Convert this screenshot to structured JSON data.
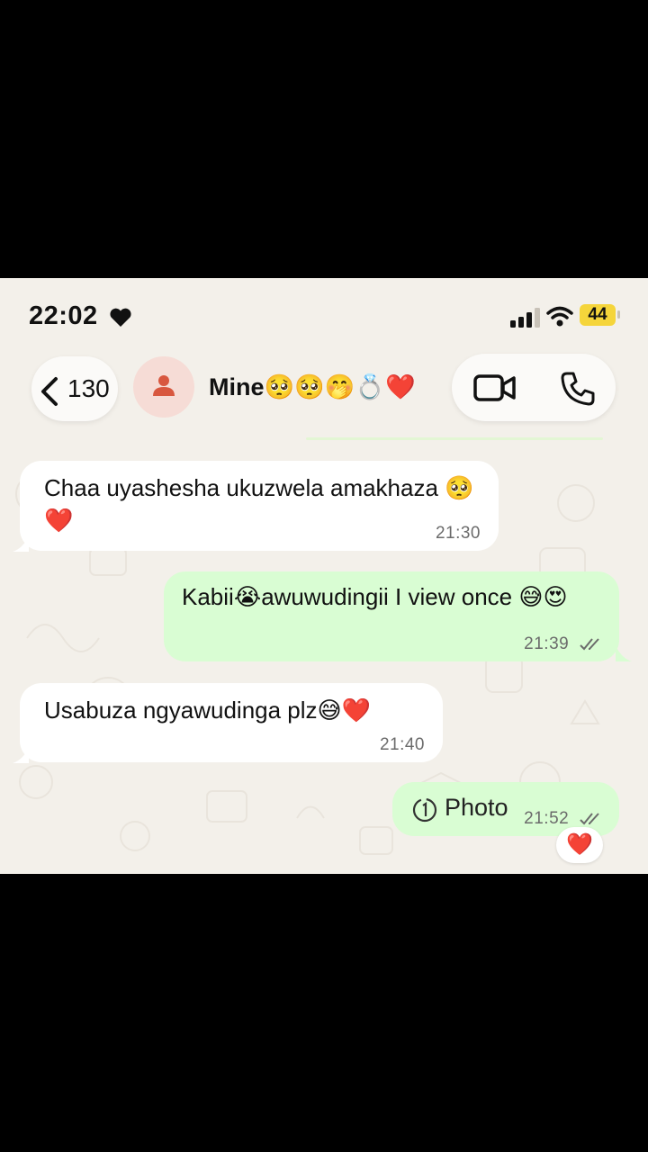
{
  "status_bar": {
    "time": "22:02",
    "battery": "44"
  },
  "header": {
    "back_count": "130",
    "contact_name": "Mine🥺🥺🤭💍❤️"
  },
  "messages": [
    {
      "direction": "in",
      "text": "Chaa uyashesha ukuzwela amakhaza 🥺❤️",
      "time": "21:30"
    },
    {
      "direction": "out",
      "text": "Kabii😭awuwudingii I view once 😅😍",
      "time": "21:39"
    },
    {
      "direction": "in",
      "text": "Usabuza ngyawudinga plz😅❤️",
      "time": "21:40"
    },
    {
      "direction": "out",
      "type": "view-once-photo",
      "label": "Photo",
      "time": "21:52",
      "reaction": "❤️"
    }
  ],
  "colors": {
    "incoming_bubble": "#ffffff",
    "outgoing_bubble": "#d9fdd3",
    "wallpaper": "#f3f0ea",
    "battery": "#f5d53b"
  }
}
